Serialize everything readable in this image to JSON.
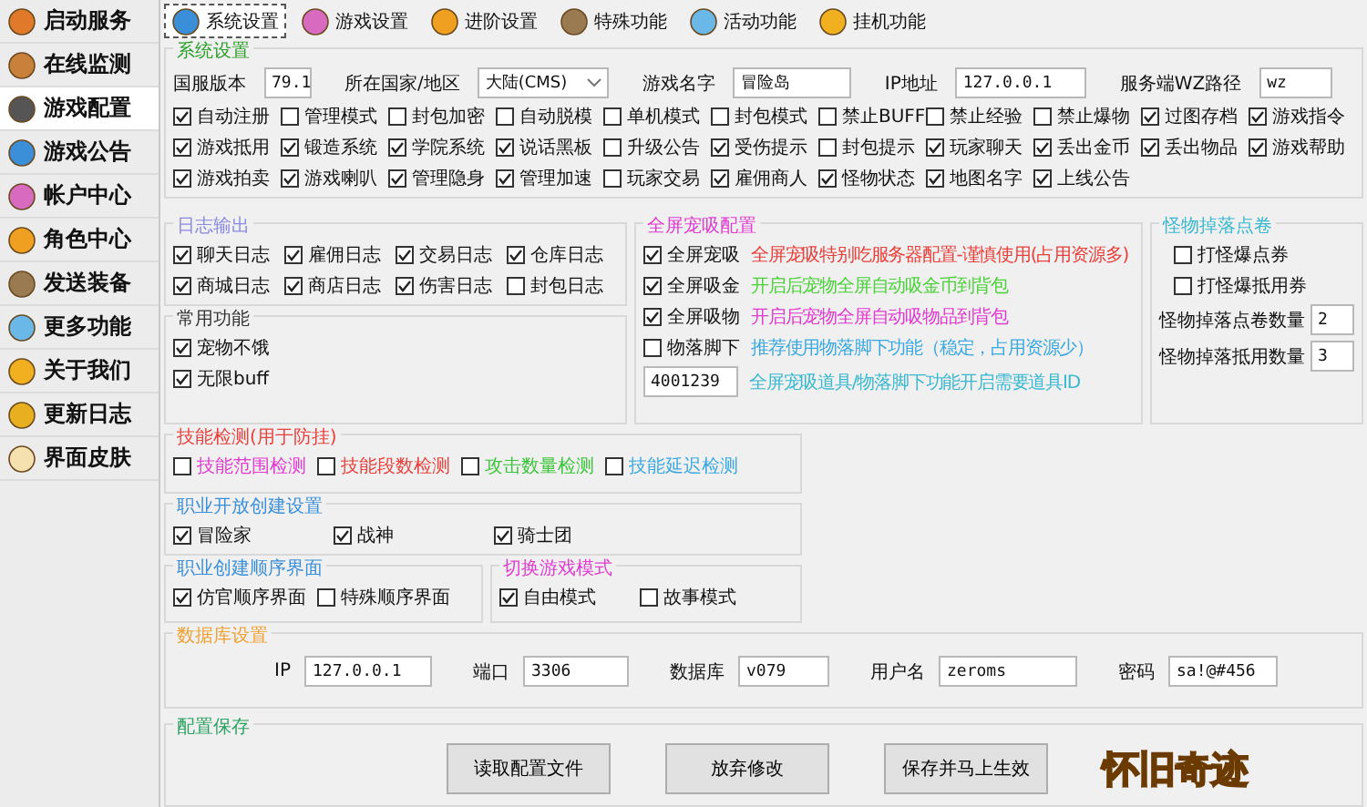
{
  "sidebar": {
    "items": [
      {
        "label": "启动服务",
        "selected": false
      },
      {
        "label": "在线监测",
        "selected": false
      },
      {
        "label": "游戏配置",
        "selected": true
      },
      {
        "label": "游戏公告",
        "selected": false
      },
      {
        "label": "帐户中心",
        "selected": false
      },
      {
        "label": "角色中心",
        "selected": false
      },
      {
        "label": "发送装备",
        "selected": false
      },
      {
        "label": "更多功能",
        "selected": false
      },
      {
        "label": "关于我们",
        "selected": false
      },
      {
        "label": "更新日志",
        "selected": false
      },
      {
        "label": "界面皮肤",
        "selected": false
      }
    ]
  },
  "tabs": [
    {
      "label": "系统设置",
      "selected": true
    },
    {
      "label": "游戏设置",
      "selected": false
    },
    {
      "label": "进阶设置",
      "selected": false
    },
    {
      "label": "特殊功能",
      "selected": false
    },
    {
      "label": "活动功能",
      "selected": false
    },
    {
      "label": "挂机功能",
      "selected": false
    }
  ],
  "system": {
    "title": "系统设置",
    "fields": [
      {
        "label": "国服版本",
        "value": "79.1",
        "kind": "text"
      },
      {
        "label": "所在国家/地区",
        "value": "大陆(CMS)",
        "kind": "select"
      },
      {
        "label": "游戏名字",
        "value": "冒险岛",
        "kind": "text"
      },
      {
        "label": "IP地址",
        "value": "127.0.0.1",
        "kind": "text"
      },
      {
        "label": "服务端WZ路径",
        "value": "wz",
        "kind": "text"
      }
    ],
    "options": [
      {
        "label": "自动注册",
        "checked": true
      },
      {
        "label": "管理模式",
        "checked": false
      },
      {
        "label": "封包加密",
        "checked": false
      },
      {
        "label": "自动脱模",
        "checked": false
      },
      {
        "label": "单机模式",
        "checked": false
      },
      {
        "label": "封包模式",
        "checked": false
      },
      {
        "label": "禁止BUFF",
        "checked": false
      },
      {
        "label": "禁止经验",
        "checked": false
      },
      {
        "label": "禁止爆物",
        "checked": false
      },
      {
        "label": "过图存档",
        "checked": true
      },
      {
        "label": "游戏指令",
        "checked": true
      },
      {
        "label": "游戏抵用",
        "checked": true
      },
      {
        "label": "锻造系统",
        "checked": true
      },
      {
        "label": "学院系统",
        "checked": true
      },
      {
        "label": "说话黑板",
        "checked": true
      },
      {
        "label": "升级公告",
        "checked": false
      },
      {
        "label": "受伤提示",
        "checked": true
      },
      {
        "label": "封包提示",
        "checked": false
      },
      {
        "label": "玩家聊天",
        "checked": true
      },
      {
        "label": "丢出金币",
        "checked": true
      },
      {
        "label": "丢出物品",
        "checked": true
      },
      {
        "label": "游戏帮助",
        "checked": true
      },
      {
        "label": "游戏拍卖",
        "checked": true
      },
      {
        "label": "游戏喇叭",
        "checked": true
      },
      {
        "label": "管理隐身",
        "checked": true
      },
      {
        "label": "管理加速",
        "checked": true
      },
      {
        "label": "玩家交易",
        "checked": false
      },
      {
        "label": "雇佣商人",
        "checked": true
      },
      {
        "label": "怪物状态",
        "checked": true
      },
      {
        "label": "地图名字",
        "checked": true
      },
      {
        "label": "上线公告",
        "checked": true
      }
    ]
  },
  "log_output": {
    "title": "日志输出",
    "options": [
      {
        "label": "聊天日志",
        "checked": true
      },
      {
        "label": "雇佣日志",
        "checked": true
      },
      {
        "label": "交易日志",
        "checked": true
      },
      {
        "label": "仓库日志",
        "checked": true
      },
      {
        "label": "商城日志",
        "checked": true
      },
      {
        "label": "商店日志",
        "checked": true
      },
      {
        "label": "伤害日志",
        "checked": true
      },
      {
        "label": "封包日志",
        "checked": false
      }
    ]
  },
  "common": {
    "title": "常用功能",
    "options": [
      {
        "label": "宠物不饿",
        "checked": true
      },
      {
        "label": "无限buff",
        "checked": true
      }
    ]
  },
  "pickup": {
    "title": "全屏宠吸配置",
    "rows": [
      {
        "label": "全屏宠吸",
        "checked": true,
        "note": "全屏宠吸特别吃服务器配置-谨慎使用(占用资源多)",
        "color": "#e8413c"
      },
      {
        "label": "全屏吸金",
        "checked": true,
        "note": "开启后宠物全屏自动吸金币到背包",
        "color": "#4cd13a"
      },
      {
        "label": "全屏吸物",
        "checked": true,
        "note": "开启后宠物全屏自动吸物品到背包",
        "color": "#e03ad0"
      },
      {
        "label": "物落脚下",
        "checked": false,
        "note": "推荐使用物落脚下功能（稳定，占用资源少）",
        "color": "#3aa8e0"
      }
    ],
    "item_id": {
      "value": "4001239",
      "note": "全屏宠吸道具/物落脚下功能开启需要道具ID"
    }
  },
  "drop_coupons": {
    "title": "怪物掉落点卷",
    "options": [
      {
        "label": "打怪爆点券",
        "checked": false
      },
      {
        "label": "打怪爆抵用券",
        "checked": false
      }
    ],
    "fields": [
      {
        "label": "怪物掉落点卷数量",
        "value": "2"
      },
      {
        "label": "怪物掉落抵用数量",
        "value": "3"
      }
    ]
  },
  "skill_check": {
    "title": "技能检测(用于防挂)",
    "options": [
      {
        "label": "技能范围检测",
        "checked": false,
        "color": "#e03ad0"
      },
      {
        "label": "技能段数检测",
        "checked": false,
        "color": "#e8413c"
      },
      {
        "label": "攻击数量检测",
        "checked": false,
        "color": "#3cc43a"
      },
      {
        "label": "技能延迟检测",
        "checked": false,
        "color": "#3aa8e0"
      }
    ]
  },
  "job_create": {
    "title": "职业开放创建设置",
    "options": [
      {
        "label": "冒险家",
        "checked": true
      },
      {
        "label": "战神",
        "checked": true
      },
      {
        "label": "骑士团",
        "checked": true
      }
    ]
  },
  "job_order": {
    "title": "职业创建顺序界面",
    "options": [
      {
        "label": "仿官顺序界面",
        "checked": true
      },
      {
        "label": "特殊顺序界面",
        "checked": false
      }
    ]
  },
  "game_mode": {
    "title": "切换游戏模式",
    "options": [
      {
        "label": "自由模式",
        "checked": true
      },
      {
        "label": "故事模式",
        "checked": false
      }
    ]
  },
  "database": {
    "title": "数据库设置",
    "fields": [
      {
        "label": "IP",
        "value": "127.0.0.1"
      },
      {
        "label": "端口",
        "value": "3306"
      },
      {
        "label": "数据库",
        "value": "v079"
      },
      {
        "label": "用户名",
        "value": "zeroms"
      },
      {
        "label": "密码",
        "value": "sa!@#456"
      }
    ]
  },
  "config_save": {
    "title": "配置保存",
    "buttons": [
      "读取配置文件",
      "放弃修改",
      "保存并马上生效"
    ]
  },
  "logo": {
    "text": "怀旧奇迹"
  }
}
